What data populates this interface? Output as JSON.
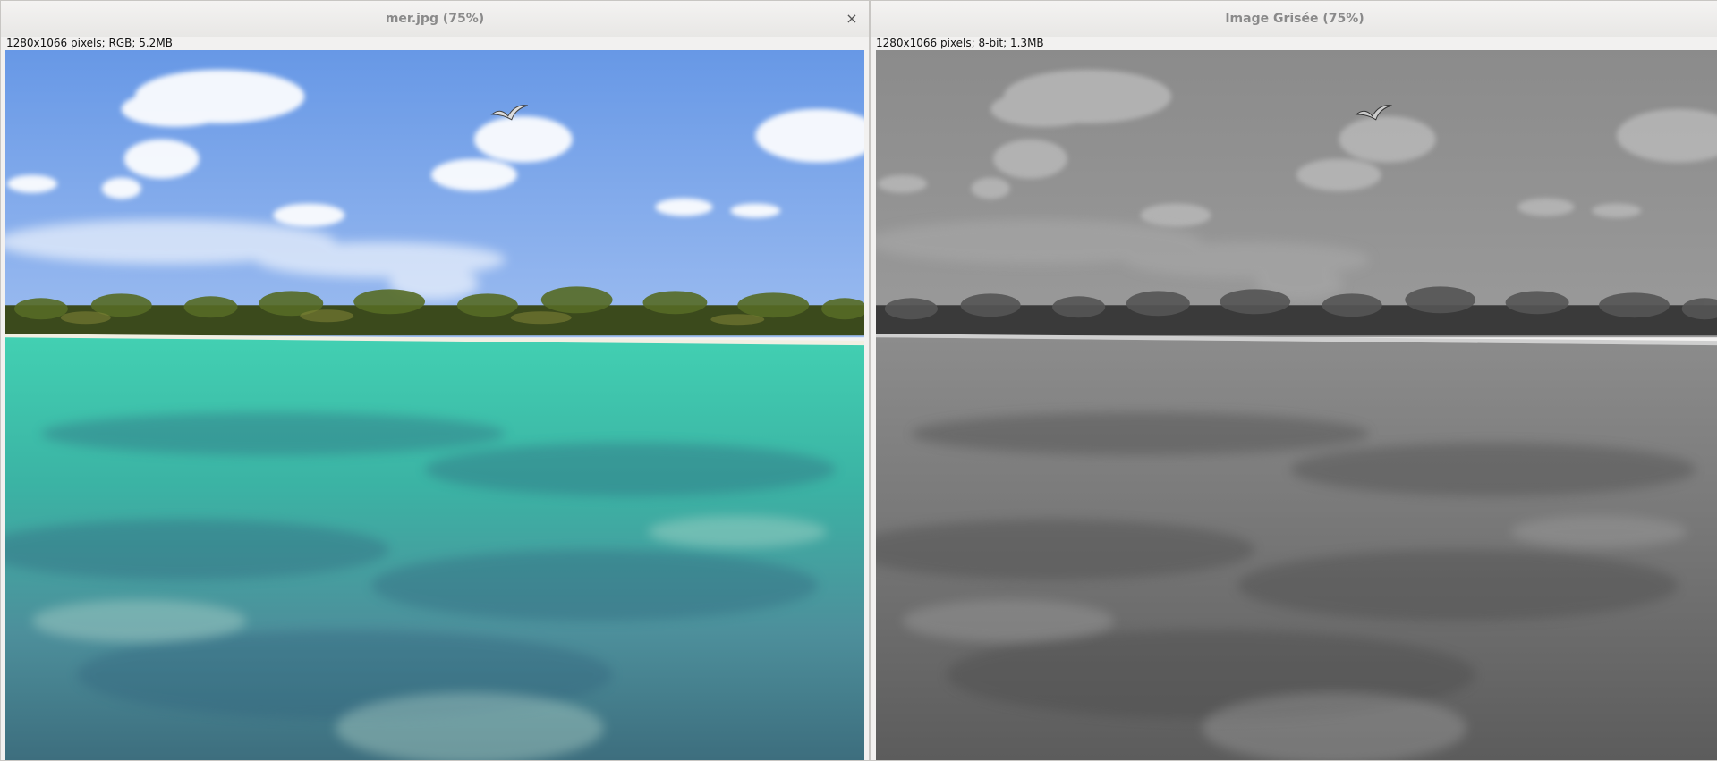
{
  "windows": {
    "original": {
      "title": "mer.jpg (75%)",
      "info": "1280x1066 pixels; RGB; 5.2MB",
      "close_symbol": "×"
    },
    "grayscale": {
      "title": "Image Grisée (75%)",
      "info": "1280x1066 pixels; 8-bit; 1.3MB"
    }
  },
  "colors": {
    "sky_top": "#6a9de6",
    "sky_bottom": "#8fb4ef",
    "sea_near": "#3fc4ad",
    "sea_far": "#3f6f8a",
    "palms": "#3c4a1e"
  }
}
